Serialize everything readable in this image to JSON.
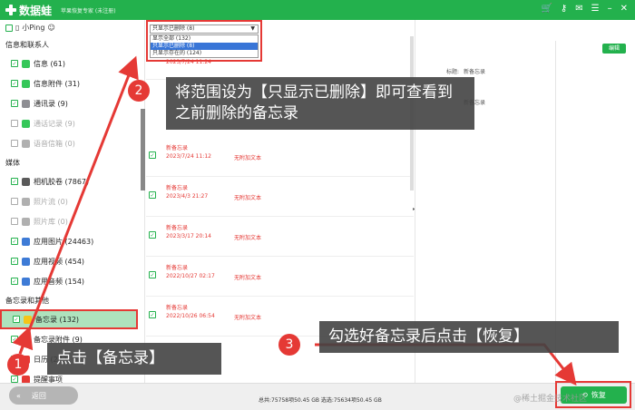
{
  "app": {
    "name": "数据蛙",
    "subtitle": "苹果恢复专家 (未注册)"
  },
  "device": {
    "name": "小Ping"
  },
  "sidebar": {
    "section1": "信息和联系人",
    "items1": [
      {
        "label": "信息 (61)",
        "checked": true,
        "color": "#35c759"
      },
      {
        "label": "信息附件 (31)",
        "checked": true,
        "color": "#35c759"
      },
      {
        "label": "通讯录 (9)",
        "checked": true,
        "color": "#8e8e93"
      },
      {
        "label": "通话记录 (9)",
        "checked": false,
        "color": "#35c759",
        "muted": true
      },
      {
        "label": "语音信箱 (0)",
        "checked": false,
        "color": "#b0b0b0",
        "muted": true
      }
    ],
    "section2": "媒体",
    "items2": [
      {
        "label": "相机胶卷 (7867)",
        "checked": true,
        "color": "#5a5a5a"
      },
      {
        "label": "照片流 (0)",
        "checked": false,
        "color": "#b0b0b0",
        "muted": true
      },
      {
        "label": "照片库 (0)",
        "checked": false,
        "color": "#b0b0b0",
        "muted": true
      },
      {
        "label": "应用图片 (24463)",
        "checked": true,
        "color": "#3e7bd6"
      },
      {
        "label": "应用视频 (454)",
        "checked": true,
        "color": "#3e7bd6"
      },
      {
        "label": "应用音频 (154)",
        "checked": true,
        "color": "#3e7bd6"
      }
    ],
    "section3": "备忘录和其他",
    "items3": [
      {
        "label": "备忘录 (132)",
        "checked": true,
        "color": "#f5c518",
        "active": true
      },
      {
        "label": "备忘录附件 (9)",
        "checked": true,
        "color": "#f5c518"
      },
      {
        "label": "日历 (273)",
        "checked": true,
        "color": "#e53935"
      },
      {
        "label": "提醒事项",
        "checked": true,
        "color": "#e53935"
      }
    ]
  },
  "dropdown": {
    "value": "只显示已删除 (8)",
    "options": [
      "显示全部 (132)",
      "只显示已删除 (8)",
      "只显示存在的 (124)"
    ],
    "selected_index": 1
  },
  "notes": [
    {
      "title": "新备忘录",
      "date": "2023/7/24 11:12",
      "text": "无附加文本"
    },
    {
      "title": "新备忘录",
      "date": "2023/4/3 21:27",
      "text": "无附加文本"
    },
    {
      "title": "新备忘录",
      "date": "2023/3/17 20:14",
      "text": "无附加文本"
    },
    {
      "title": "新备忘录",
      "date": "2022/10/27 02:17",
      "text": "无附加文本"
    },
    {
      "title": "新备忘录",
      "date": "2022/10/26 06:54",
      "text": "无附加文本"
    }
  ],
  "partial_row_date": "2023/7/24 11:24",
  "right_pane": {
    "label_a": "标题:",
    "value_a": "新备忘录",
    "label_b": "新备忘录",
    "edit_label": "编辑"
  },
  "bottom": {
    "back_label": "返回",
    "totals": "总共:75758项50.45 GB 选选:75634项50.45 GB",
    "restore_label": "恢复",
    "watermark": "@稀土掘金技术社区"
  },
  "callouts": [
    {
      "num": "1",
      "text": "点击【备忘录】"
    },
    {
      "num": "2",
      "text": "将范围设为【只显示已删除】即可查看到之前删除的备忘录"
    },
    {
      "num": "3",
      "text": "勾选好备忘录后点击【恢复】"
    }
  ],
  "colors": {
    "brand": "#23b14d",
    "highlight": "#e53935",
    "callout_bg": "#424242"
  }
}
